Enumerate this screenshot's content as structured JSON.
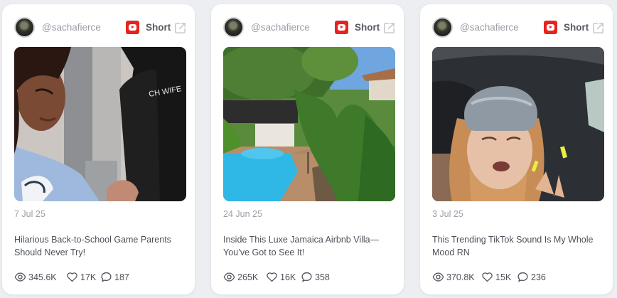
{
  "cards": [
    {
      "username": "@sachafierce",
      "platform_label": "Short",
      "date": "7 Jul 25",
      "title": "Hilarious Back-to-School Game Parents Should Never Try!",
      "views": "345.6K",
      "likes": "17K",
      "comments": "187"
    },
    {
      "username": "@sachafierce",
      "platform_label": "Short",
      "date": "24 Jun 25",
      "title": "Inside This Luxe Jamaica Airbnb Villa—You’ve Got to See It!",
      "views": "265K",
      "likes": "16K",
      "comments": "358"
    },
    {
      "username": "@sachafierce",
      "platform_label": "Short",
      "date": "3 Jul 25",
      "title": "This Trending TikTok Sound Is My Whole Mood RN",
      "views": "370.8K",
      "likes": "15K",
      "comments": "236"
    }
  ],
  "icons": {
    "platform": "youtube-icon",
    "external": "external-link-icon",
    "views": "eye-icon",
    "likes": "heart-icon",
    "comments": "comment-icon"
  },
  "colors": {
    "youtube_red": "#e8231f",
    "muted_text": "#9a9ea5",
    "body_text": "#4c5058",
    "background": "#eceef2"
  }
}
